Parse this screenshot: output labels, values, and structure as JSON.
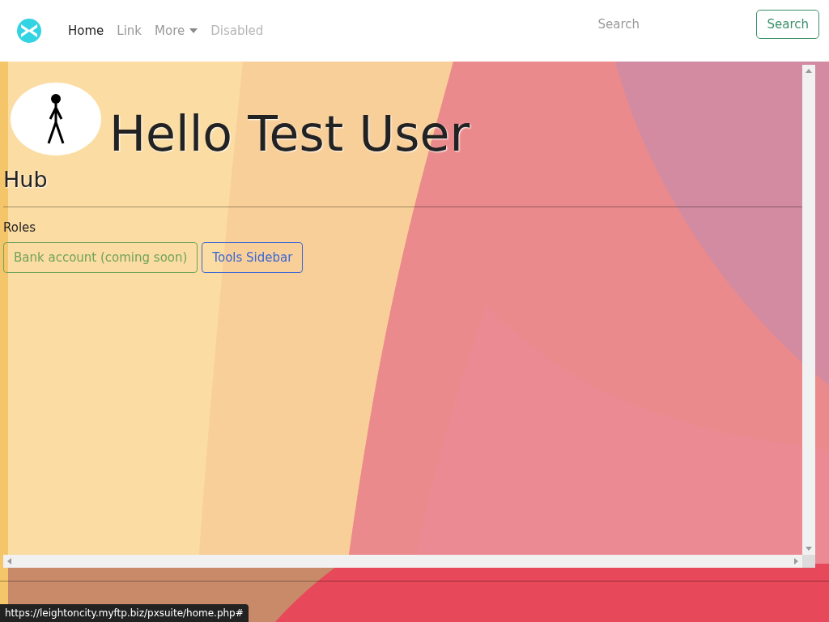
{
  "navbar": {
    "items": [
      {
        "label": "Home",
        "selected": true,
        "disabled": false,
        "kind": "link"
      },
      {
        "label": "Link",
        "selected": false,
        "disabled": false,
        "kind": "link"
      },
      {
        "label": "More",
        "selected": false,
        "disabled": false,
        "kind": "dropdown"
      },
      {
        "label": "Disabled",
        "selected": false,
        "disabled": true,
        "kind": "link"
      }
    ],
    "search": {
      "placeholder": "Search"
    },
    "search_button": "Search"
  },
  "frame": {
    "title": "Hello Test User",
    "heading": "Hub",
    "roles_label": "Roles",
    "buttons": [
      {
        "label": "Bank account (coming soon)",
        "color": "#6fa35a"
      },
      {
        "label": "Tools Sidebar",
        "color": "#3a66d6"
      }
    ]
  },
  "status_bar": {
    "url": "https://leightoncity.myftp.biz/pxsuite/home.php#"
  }
}
